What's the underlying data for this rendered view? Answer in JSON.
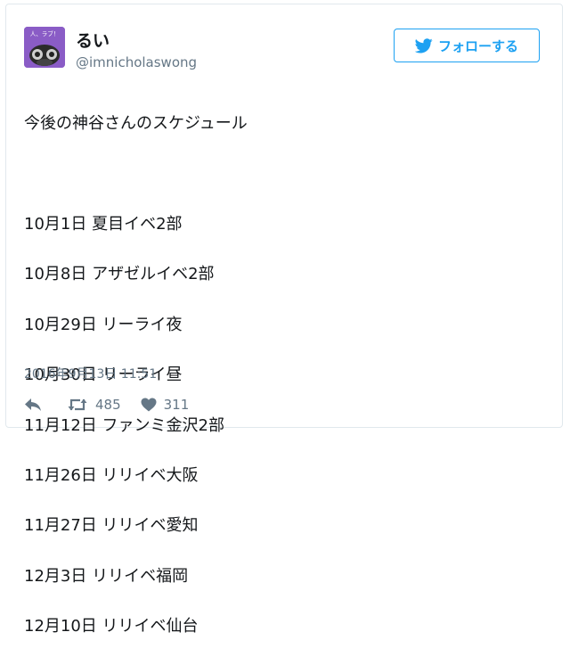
{
  "author": {
    "display_name": "るい",
    "handle": "@imnicholaswong",
    "avatar_text": "人、ラブ！"
  },
  "follow_button": {
    "label": "フォローする"
  },
  "tweet": {
    "lines": [
      "今後の神谷さんのスケジュール",
      "",
      "10月1日 夏目イベ2部",
      "10月8日 アザゼルイベ2部",
      "10月29日 リーライ夜",
      "10月30日 リーライ昼",
      "11月12日 ファンミ金沢2部",
      "11月26日 リリイベ大阪",
      "11月27日 リリイベ愛知",
      "12月3日 リリイベ福岡",
      "12月10日 リリイベ仙台"
    ],
    "timestamp": "2016年9月13日 11:51"
  },
  "actions": {
    "reply_icon": "reply-icon",
    "retweet_icon": "retweet-icon",
    "retweet_count": "485",
    "like_icon": "heart-icon",
    "like_count": "311"
  },
  "colors": {
    "accent": "#1da1f2",
    "secondary_text": "#657786",
    "border": "#e1e8ed",
    "avatar_bg": "#8a5cc6"
  }
}
